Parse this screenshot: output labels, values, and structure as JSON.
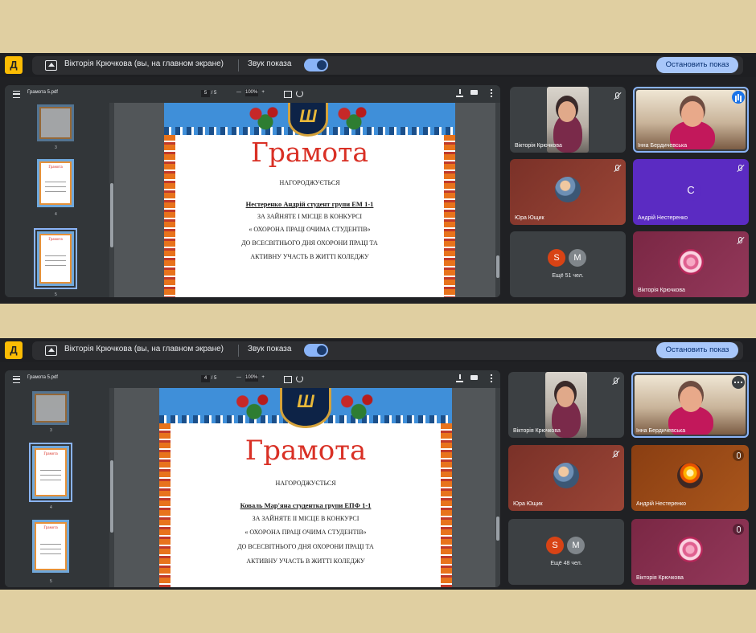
{
  "colors": {
    "background": "#e0cfa1",
    "meet_dark": "#202124",
    "accent": "#a8c7fa",
    "certificate_title": "#d93025"
  },
  "screenshots": [
    {
      "app_logo_icon": "meet-logo-icon",
      "presenter_text": "Вікторія Крючкова (вы, на главном экране)",
      "sound_label": "Звук показа",
      "stop_button": "Остановить показ",
      "pdf": {
        "file_name": "Грамота 5.pdf",
        "page_current": "5",
        "page_sep": "/",
        "page_total": "5",
        "zoom_minus": "—",
        "zoom_value": "100%",
        "zoom_plus": "+",
        "thumbnail_numbers": [
          "3",
          "4",
          "5"
        ],
        "selected_thumbnail": "5",
        "certificate": {
          "title": "Грамота",
          "awarded": "НАГОРОДЖУЄТЬСЯ",
          "recipient": "Нестеренко Андрій студент групи ЕМ 1-1",
          "line1": "ЗА ЗАЙНЯТЕ І МІСЦЕ В КОНКУРСІ",
          "line2": "« ОХОРОНА ПРАЦІ ОЧИМА СТУДЕНТІВ»",
          "line3": "ДО ВСЕСВІТНЬОГО ДНЯ ОХОРОНИ ПРАЦІ ТА",
          "line4": "АКТИВНУ УЧАСТЬ В ЖИТТІ КОЛЕДЖУ"
        }
      },
      "participants": [
        {
          "name": "Вікторія Крючкова",
          "kind": "video",
          "icon": "mic-off-icon"
        },
        {
          "name": "Інна Бердичевська",
          "kind": "video",
          "icon": "speaking-icon"
        },
        {
          "name": "Юра Ющик",
          "kind": "avatar",
          "icon": "mic-off-icon"
        },
        {
          "name": "Андрій Нестеренко",
          "kind": "letter",
          "letter": "С",
          "icon": "mic-off-icon"
        },
        {
          "kind": "more",
          "initials": [
            "S",
            "M"
          ],
          "count_text": "Ещё 51 чел."
        },
        {
          "name": "Вікторія Крючкова",
          "kind": "avatar",
          "icon": "mic-off-icon"
        }
      ]
    },
    {
      "app_logo_icon": "meet-logo-icon",
      "presenter_text": "Вікторія Крючкова (вы, на главном экране)",
      "sound_label": "Звук показа",
      "stop_button": "Остановить показ",
      "pdf": {
        "file_name": "Грамота 5.pdf",
        "page_current": "4",
        "page_sep": "/",
        "page_total": "5",
        "zoom_minus": "—",
        "zoom_value": "100%",
        "zoom_plus": "+",
        "thumbnail_numbers": [
          "3",
          "4",
          "5"
        ],
        "selected_thumbnail": "4",
        "certificate": {
          "title": "Грамота",
          "awarded": "НАГОРОДЖУЄТЬСЯ",
          "recipient": "Коваль Мар'яна студентка групи ЕПФ 1-1",
          "line1": "ЗА ЗАЙНЯТЕ ІІ МІСЦЕ В КОНКУРСІ",
          "line2": "« ОХОРОНА ПРАЦІ ОЧИМА СТУДЕНТІВ»",
          "line3": "ДО ВСЕСВІТНЬОГО ДНЯ ОХОРОНИ ПРАЦІ ТА",
          "line4": "АКТИВНУ УЧАСТЬ В ЖИТТІ КОЛЕДЖУ"
        }
      },
      "participants": [
        {
          "name": "Вікторія Крючкова",
          "kind": "video",
          "icon": "mic-off-icon"
        },
        {
          "name": "Інна Бердичевська",
          "kind": "video",
          "icon": "more-options-icon"
        },
        {
          "name": "Юра Ющик",
          "kind": "avatar",
          "icon": "mic-off-icon"
        },
        {
          "name": "Андрій Нестеренко",
          "kind": "avatar",
          "icon": "mic-off-icon"
        },
        {
          "kind": "more",
          "initials": [
            "S",
            "M"
          ],
          "count_text": "Ещё 48 чел."
        },
        {
          "name": "Вікторія Крючкова",
          "kind": "avatar",
          "icon": "mic-off-icon"
        }
      ]
    }
  ]
}
